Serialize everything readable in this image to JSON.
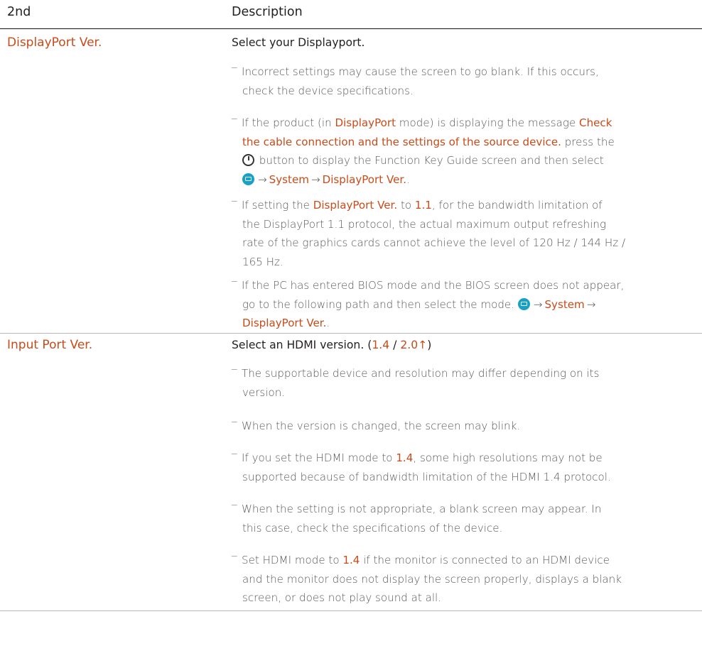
{
  "header": {
    "col1": "2nd",
    "col2": "Description"
  },
  "rows": [
    {
      "name": "DisplayPort Ver.",
      "desc": "Select your Displayport.",
      "notes": {
        "n1": {
          "l1": "Incorrect settings may cause the screen to go blank. If this occurs,",
          "l2": "check the device specifications."
        },
        "n2": {
          "a": "If the product (in ",
          "b": "DisplayPort",
          "c": " mode) is displaying the message ",
          "d": "Check",
          "e": "the cable connection and the settings of the source device.",
          "f": " press the",
          "g": " button to display the Function Key Guide screen and then select",
          "h": "System",
          "i": "DisplayPort Ver.",
          "j": "."
        },
        "n3": {
          "a": "If setting the ",
          "b": "DisplayPort Ver.",
          "c": " to ",
          "d": "1.1",
          "e": ", for the bandwidth limitation of",
          "l2": "the DisplayPort 1.1 protocol, the actual maximum output refreshing",
          "l3": "rate of the graphics cards cannot achieve the level of 120 Hz / 144 Hz /",
          "l4": "165 Hz."
        },
        "n4": {
          "l1": "If the PC has entered BIOS mode and the BIOS screen does not appear,",
          "a": "go to the following path and then select the mode. ",
          "b": "System",
          "c": "DisplayPort Ver.",
          "d": "."
        }
      }
    },
    {
      "name": "Input Port Ver.",
      "desc": {
        "a": "Select an HDMI version. (",
        "b": "1.4",
        "c": " / ",
        "d": "2.0↑",
        "e": ")"
      },
      "notes": {
        "n1": {
          "l1": "The supportable device and resolution may differ depending on its",
          "l2": "version."
        },
        "n2": {
          "l1": "When the version is changed, the screen may blink."
        },
        "n3": {
          "a": "If you set the HDMI mode to ",
          "b": "1.4",
          "c": ", some high resolutions may not be",
          "l2": "supported because of bandwidth limitation of the HDMI 1.4 protocol."
        },
        "n4": {
          "l1": "When the setting is not appropriate, a blank screen may appear. In",
          "l2": "this case, check the specifications of the device."
        },
        "n5": {
          "a": "Set HDMI mode to ",
          "b": "1.4",
          "c": " if the monitor is connected to an HDMI device",
          "l2": "and the monitor does not display the screen properly, displays a blank",
          "l3": "screen, or does not play sound at all."
        }
      }
    }
  ],
  "symbols": {
    "note_dash": "‾",
    "arrow": "→",
    "power_icon": "power-icon",
    "menu_icon": "menu-icon"
  },
  "colors": {
    "accent": "#c84b1a",
    "menu_icon": "#16a2c6"
  }
}
